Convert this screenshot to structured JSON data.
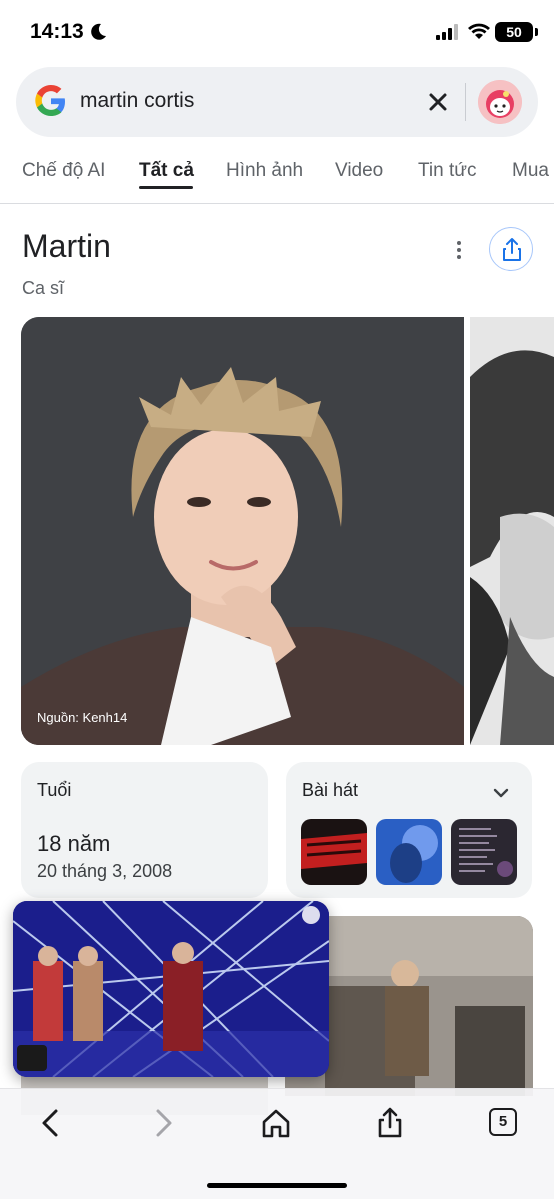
{
  "status_bar": {
    "time": "14:13",
    "battery": "50"
  },
  "search": {
    "query": "martin cortis"
  },
  "tabs": [
    {
      "label": "Chế độ AI",
      "active": false
    },
    {
      "label": "Tất cả",
      "active": true
    },
    {
      "label": "Hình ảnh",
      "active": false
    },
    {
      "label": "Video",
      "active": false
    },
    {
      "label": "Tin tức",
      "active": false
    },
    {
      "label": "Mua",
      "active": false
    }
  ],
  "entity": {
    "title": "Martin",
    "subtitle": "Ca sĩ",
    "photo_caption": "Nguồn: Kenh14"
  },
  "cards": {
    "age": {
      "label": "Tuổi",
      "value": "18 năm",
      "date": "20 tháng 3, 2008"
    },
    "songs": {
      "label": "Bài hát",
      "thumbs": [
        "redred-album",
        "blue-portrait-album",
        "tracklist-album"
      ]
    }
  },
  "toolbar": {
    "tab_count": "5"
  },
  "colors": {
    "accent_blue": "#1a73e8",
    "chip_bg": "#f1f3f4",
    "search_bg": "#eef0f3"
  }
}
